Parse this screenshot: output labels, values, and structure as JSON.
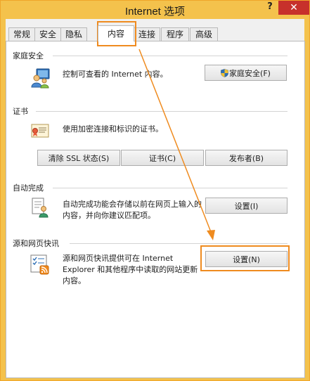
{
  "window": {
    "title": "Internet 选项",
    "help_label": "?",
    "close_label": "✕"
  },
  "tabs": [
    {
      "label": "常规"
    },
    {
      "label": "安全"
    },
    {
      "label": "隐私"
    },
    {
      "label": "内容"
    },
    {
      "label": "连接"
    },
    {
      "label": "程序"
    },
    {
      "label": "高级"
    }
  ],
  "active_tab": "内容",
  "family_safety": {
    "label": "家庭安全",
    "description": "控制可查看的 Internet 内容。",
    "button": "家庭安全(F)"
  },
  "certificates": {
    "label": "证书",
    "description": "使用加密连接和标识的证书。",
    "clear_ssl_button": "清除 SSL 状态(S)",
    "certificates_button": "证书(C)",
    "publishers_button": "发布者(B)"
  },
  "autocomplete": {
    "label": "自动完成",
    "description_line1": "自动完成功能会存储以前在网页上输入的",
    "description_line2": "内容，并向你建议匹配项。",
    "settings_button": "设置(I)"
  },
  "feeds": {
    "label": "源和网页快讯",
    "description_line1": "源和网页快讯提供可在 Internet",
    "description_line2": "Explorer 和其他程序中读取的网站更新",
    "description_line3": "内容。",
    "settings_button": "设置(N)"
  },
  "annotation_color": "#ef8b1f"
}
